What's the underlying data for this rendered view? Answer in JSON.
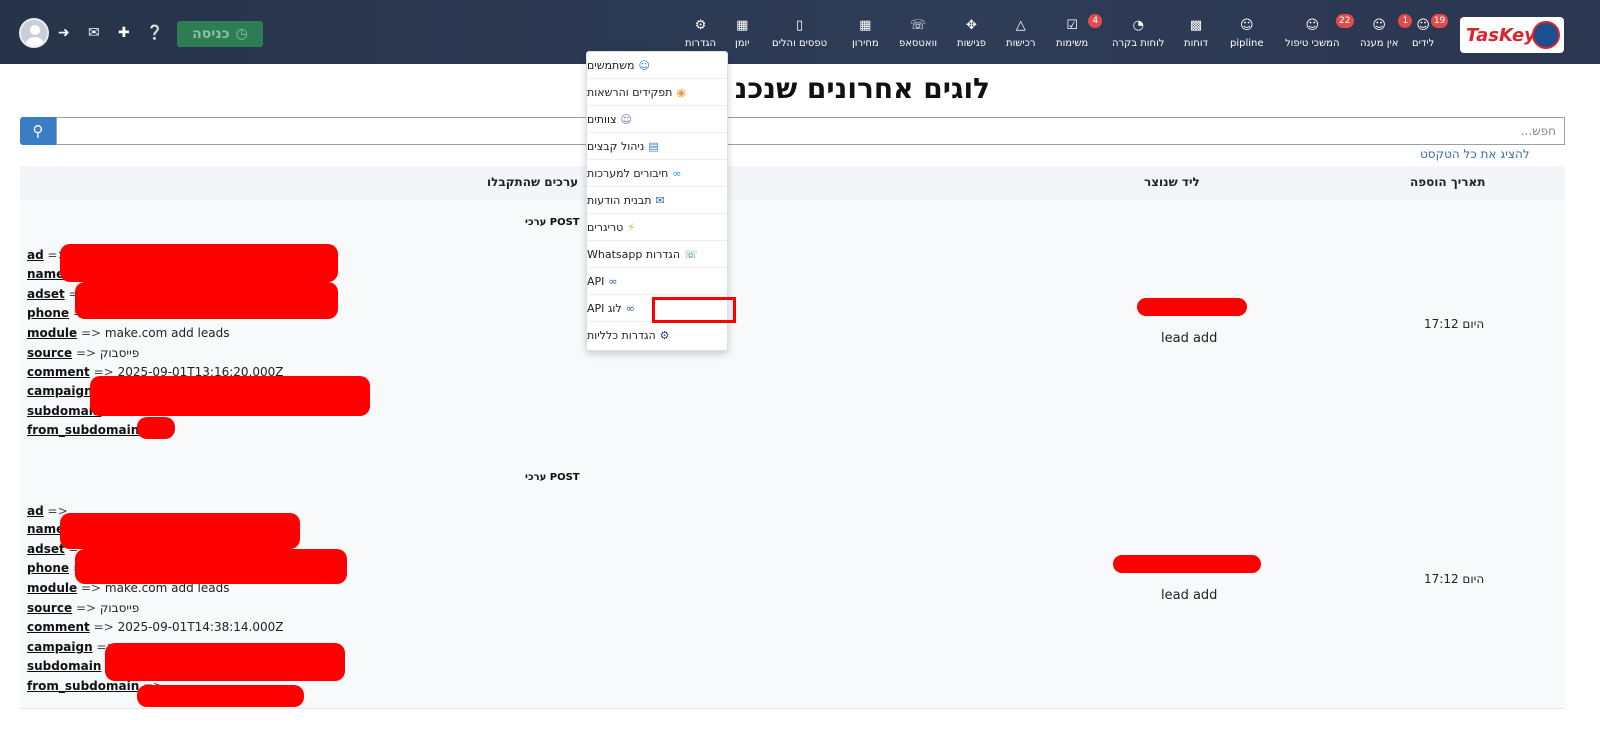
{
  "app": {
    "logo_text": "TasKey"
  },
  "nav": {
    "items": [
      {
        "label": "לידים",
        "icon": "user-icon",
        "badge": "19"
      },
      {
        "label": "אין מענה",
        "icon": "user-icon",
        "badge": "1"
      },
      {
        "label": "המשכי טיפול",
        "icon": "user-icon",
        "badge": "22"
      },
      {
        "label": "pipline",
        "icon": "user-icon",
        "badge": ""
      },
      {
        "label": "דוחות",
        "icon": "bar-chart-icon",
        "badge": ""
      },
      {
        "label": "לוחות בקרה",
        "icon": "gauge-icon",
        "badge": ""
      },
      {
        "label": "משימות",
        "icon": "checkbox-icon",
        "badge": "4"
      },
      {
        "label": "רכישות",
        "icon": "cart-icon",
        "badge": ""
      },
      {
        "label": "פגישות",
        "icon": "handshake-icon",
        "badge": ""
      },
      {
        "label": "וואטסאפ",
        "icon": "whatsapp-icon",
        "badge": ""
      },
      {
        "label": "מחירון",
        "icon": "barcode-icon",
        "badge": ""
      },
      {
        "label": "טפסים והלים",
        "icon": "book-icon",
        "badge": ""
      },
      {
        "label": "יומן",
        "icon": "calendar-icon",
        "badge": ""
      },
      {
        "label": "הגדרות",
        "icon": "gear-icon",
        "badge": ""
      }
    ],
    "login_label": "כניסה"
  },
  "page": {
    "title": "לוגים אחרונים שנכנ",
    "search_placeholder": "חפש...",
    "show_all_text": "להציג את כל הטקסט"
  },
  "table": {
    "headers": {
      "date": "תאריך הוספה",
      "lead": "ליד שנוצר",
      "values": "ערכים שהתקבלו"
    },
    "rows": [
      {
        "date": "היום 17:12",
        "lead": "lead add",
        "post_header": "ערכי POST",
        "fields": [
          {
            "key": "ad",
            "value": ""
          },
          {
            "key": "name",
            "value": ""
          },
          {
            "key": "adset",
            "value": ""
          },
          {
            "key": "phone",
            "value": ""
          },
          {
            "key": "module",
            "value": "make.com add leads"
          },
          {
            "key": "source",
            "value": "פייסבוק"
          },
          {
            "key": "comment",
            "value": "2025-09-01T13:16:20.000Z"
          },
          {
            "key": "campaign",
            "value": ""
          },
          {
            "key": "subdomain",
            "value": ""
          },
          {
            "key": "from_subdomain",
            "value": ""
          }
        ]
      },
      {
        "date": "היום 17:12",
        "lead": "lead add",
        "post_header": "ערכי POST",
        "fields": [
          {
            "key": "ad",
            "value": ""
          },
          {
            "key": "name",
            "value": ""
          },
          {
            "key": "adset",
            "value": ""
          },
          {
            "key": "phone",
            "value": ""
          },
          {
            "key": "module",
            "value": "make.com add leads"
          },
          {
            "key": "source",
            "value": "פייסבוק"
          },
          {
            "key": "comment",
            "value": "2025-09-01T14:38:14.000Z"
          },
          {
            "key": "campaign",
            "value": ""
          },
          {
            "key": "subdomain",
            "value": ""
          },
          {
            "key": "from_subdomain",
            "value": ""
          }
        ]
      }
    ]
  },
  "settings_menu": {
    "items": [
      {
        "label": "משתמשים",
        "icon": "users-icon"
      },
      {
        "label": "תפקידים והרשאות",
        "icon": "eye-icon"
      },
      {
        "label": "צוותים",
        "icon": "team-icon"
      },
      {
        "label": "ניהול קבצים",
        "icon": "file-icon"
      },
      {
        "label": "חיבורים למערכות",
        "icon": "link-icon"
      },
      {
        "label": "תבנית הודעות",
        "icon": "envelope-icon"
      },
      {
        "label": "טריגרים",
        "icon": "bolt-icon"
      },
      {
        "label": "הגדרות Whatsapp",
        "icon": "whatsapp-icon"
      },
      {
        "label": "API",
        "icon": "link-icon"
      },
      {
        "label": "לוג API",
        "icon": "link-icon"
      },
      {
        "label": "הגדרות כלליות",
        "icon": "cog-icon"
      }
    ],
    "highlighted": "לוג API"
  },
  "colors": {
    "accent": "#3b7dc4",
    "nav_bg": "#2b3650",
    "badge": "#e04b4b",
    "highlight": "#ff0000"
  }
}
